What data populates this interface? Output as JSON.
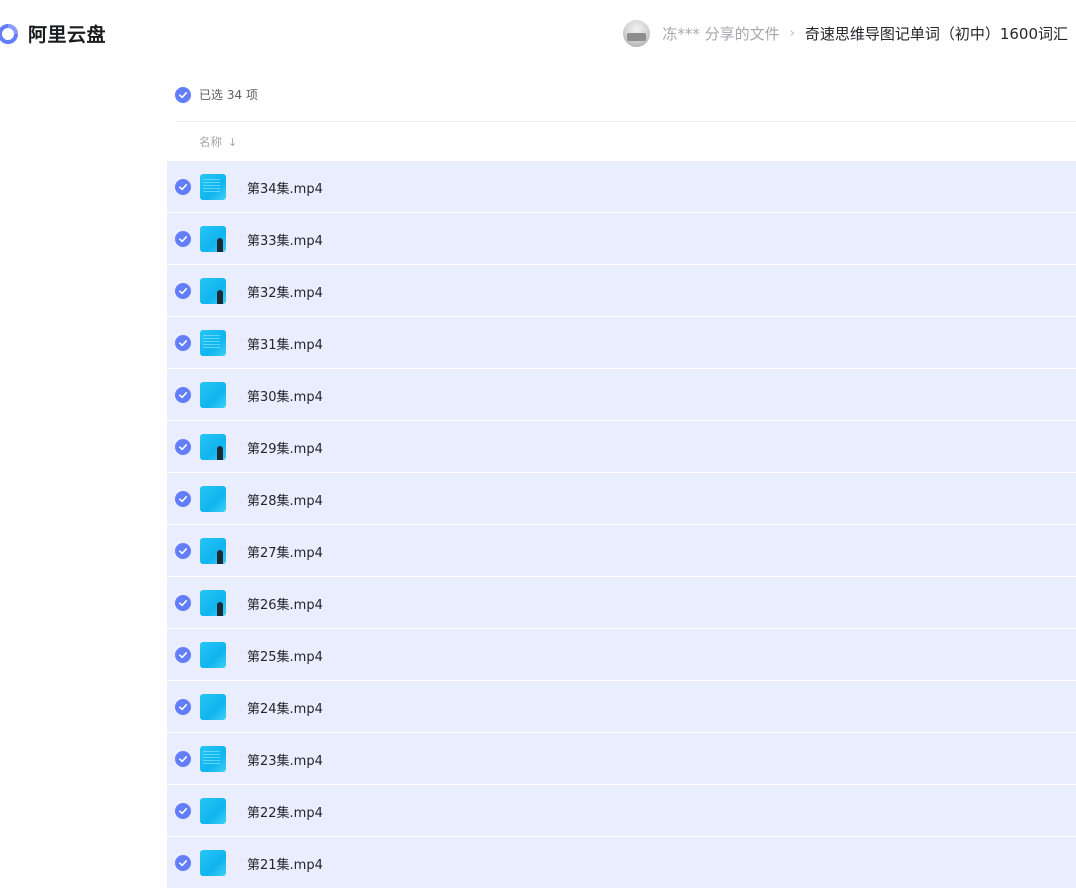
{
  "brand": {
    "name": "阿里云盘",
    "accent": "#637dff"
  },
  "share": {
    "sharer": "冻*** 分享的文件",
    "separator": "›",
    "folder": "奇速思维导图记单词（初中）1600词汇"
  },
  "selection": {
    "text": "已选 34 项",
    "checked": true
  },
  "columns": {
    "name": "名称",
    "sort_icon": "arrow-down-icon"
  },
  "files": [
    {
      "name": "第34集.mp4",
      "selected": true,
      "thumb": "text"
    },
    {
      "name": "第33集.mp4",
      "selected": true,
      "thumb": "person"
    },
    {
      "name": "第32集.mp4",
      "selected": true,
      "thumb": "person"
    },
    {
      "name": "第31集.mp4",
      "selected": true,
      "thumb": "text"
    },
    {
      "name": "第30集.mp4",
      "selected": true,
      "thumb": "plain"
    },
    {
      "name": "第29集.mp4",
      "selected": true,
      "thumb": "person"
    },
    {
      "name": "第28集.mp4",
      "selected": true,
      "thumb": "plain"
    },
    {
      "name": "第27集.mp4",
      "selected": true,
      "thumb": "person"
    },
    {
      "name": "第26集.mp4",
      "selected": true,
      "thumb": "person"
    },
    {
      "name": "第25集.mp4",
      "selected": true,
      "thumb": "plain"
    },
    {
      "name": "第24集.mp4",
      "selected": true,
      "thumb": "plain"
    },
    {
      "name": "第23集.mp4",
      "selected": true,
      "thumb": "text"
    },
    {
      "name": "第22集.mp4",
      "selected": true,
      "thumb": "plain"
    },
    {
      "name": "第21集.mp4",
      "selected": true,
      "thumb": "plain"
    }
  ]
}
